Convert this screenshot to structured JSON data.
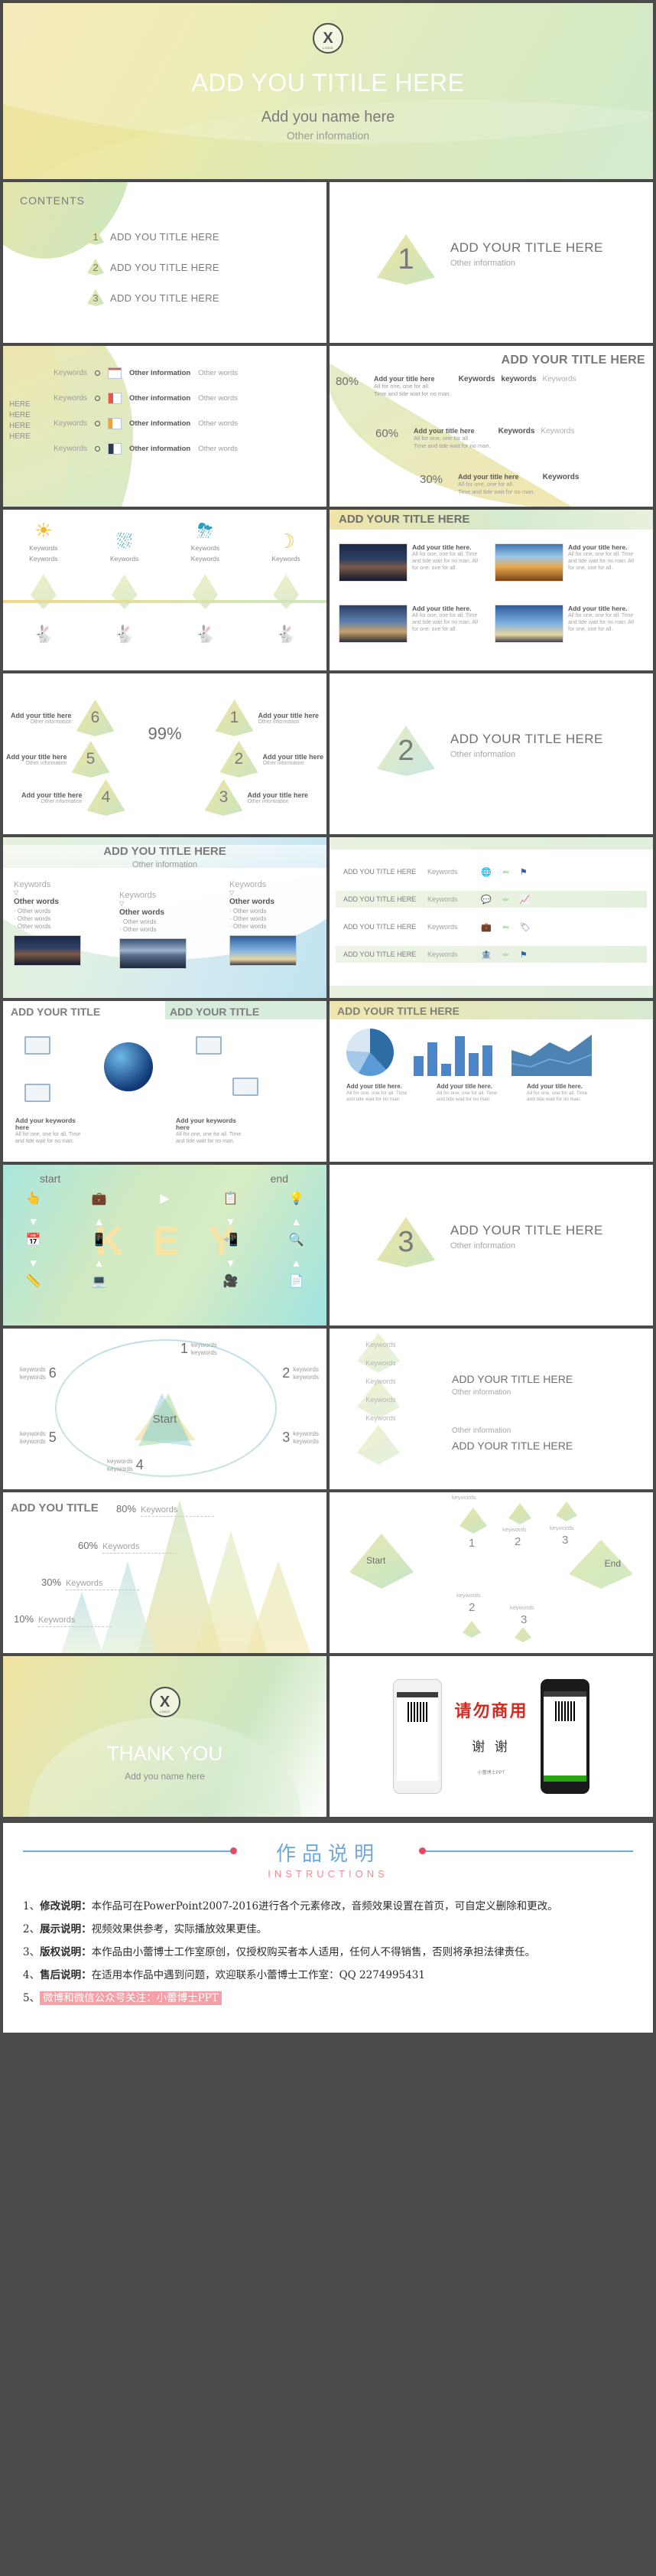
{
  "title_slide": {
    "logo": "X",
    "logo_sub": "LOGO",
    "title": "ADD YOU TITILE HERE",
    "name": "Add you name here",
    "subtitle": "Other information"
  },
  "contents_slide": {
    "heading": "CONTENTS",
    "items": [
      {
        "num": "1",
        "label": "ADD YOU TITLE HERE"
      },
      {
        "num": "2",
        "label": "ADD YOU TITLE HERE"
      },
      {
        "num": "3",
        "label": "ADD YOU TITLE HERE"
      }
    ]
  },
  "section1": {
    "num": "1",
    "title": "ADD YOUR TITLE HERE",
    "sub": "Other information"
  },
  "section2": {
    "num": "2",
    "title": "ADD YOUR TITLE HERE",
    "sub": "Other information"
  },
  "section3": {
    "num": "3",
    "title": "ADD YOUR TITLE HERE",
    "sub": "Other information"
  },
  "keywords_slide": {
    "side_labels": [
      "HERE",
      "HERE",
      "HERE",
      "HERE"
    ],
    "rows": [
      {
        "kw": "Keywords",
        "icon": "table-icon",
        "bold": "Other information",
        "light": "Other words"
      },
      {
        "kw": "Keywords",
        "icon": "contact-card-icon",
        "bold": "Other information",
        "light": "Other words"
      },
      {
        "kw": "Keywords",
        "icon": "chart-report-icon",
        "bold": "Other information",
        "light": "Other words"
      },
      {
        "kw": "Keywords",
        "icon": "media-page-icon",
        "bold": "Other information",
        "light": "Other words"
      }
    ]
  },
  "percent_slide": {
    "title": "ADD YOUR TITLE HERE",
    "rows": [
      {
        "pct": "80%",
        "title": "Add your title here",
        "line1": "All for one, one for all.",
        "line2": "Time and tide wait for no man.",
        "keywords": [
          "Keywords",
          "keywords",
          "Keywords"
        ]
      },
      {
        "pct": "60%",
        "title": "Add your title here",
        "line1": "All for one, one for all.",
        "line2": "Time and tide wait for no man.",
        "keywords": [
          "Keywords",
          "Keywords"
        ]
      },
      {
        "pct": "30%",
        "title": "Add your title here",
        "line1": "All for one, one for all.",
        "line2": "Time and tide wait for no man.",
        "keywords": [
          "Keywords"
        ]
      }
    ]
  },
  "weather_slide": {
    "columns": [
      {
        "icon": "sun-icon",
        "glyph": "☀",
        "color": "#f2b826",
        "labels": [
          "Keywords",
          "Keywords"
        ],
        "bunny": "bunny-blue-icon",
        "bunny_color": "#4aa8e0"
      },
      {
        "icon": "rain-cloud-icon",
        "glyph": "⛆",
        "color": "#2a9fc4",
        "labels": [
          "Keywords"
        ],
        "bunny": "bunny-yellow-icon",
        "bunny_color": "#e8c93c"
      },
      {
        "icon": "thunder-cloud-icon",
        "glyph": "⛈",
        "color": "#2a9fc4",
        "labels": [
          "Keywords",
          "Keywords"
        ],
        "bunny": "bunny-orange-icon",
        "bunny_color": "#f08a5d"
      },
      {
        "icon": "moon-icon",
        "glyph": "☽",
        "color": "#f2c23e",
        "labels": [
          "Keywords"
        ],
        "bunny": "bunny-green-icon",
        "bunny_color": "#7cc24a"
      }
    ]
  },
  "imagegrid_slide": {
    "title": "ADD YOUR TITLE HERE",
    "cells": [
      {
        "photo": "night-sea-photo",
        "title": "Add your title here.",
        "body": "All for one, one for all. Time and tide wait for no man. All for one, one for all."
      },
      {
        "photo": "sunset-sky-photo",
        "title": "Add your title here.",
        "body": "All for one, one for all. Time and tide wait for no man. All for one, one for all."
      },
      {
        "photo": "dawn-horizon-photo",
        "title": "Add your title here.",
        "body": "All for one, one for all. Time and tide wait for no man. All for one, one for all."
      },
      {
        "photo": "blue-sky-photo",
        "title": "Add your title here.",
        "body": "All for one, one for all. Time and tide wait for no man. All for one, one for all."
      }
    ]
  },
  "hex_slide": {
    "center": "99%",
    "nodes": [
      {
        "num": "6",
        "title": "Add your title here",
        "sub": "Other information",
        "side": "left"
      },
      {
        "num": "1",
        "title": "Add your title here",
        "sub": "Other information",
        "side": "right"
      },
      {
        "num": "5",
        "title": "Add your title here",
        "sub": "Other information",
        "side": "left"
      },
      {
        "num": "2",
        "title": "Add your title here",
        "sub": "Other information",
        "side": "right"
      },
      {
        "num": "4",
        "title": "Add your title here",
        "sub": "Other information",
        "side": "left"
      },
      {
        "num": "3",
        "title": "Add your title here",
        "sub": "Other information",
        "side": "right"
      }
    ]
  },
  "blue_slide": {
    "title": "ADD YOU TITLE HERE",
    "sub": "Other information",
    "columns": [
      {
        "kw": "Keywords",
        "head": "Other words",
        "bullets": [
          "Other words",
          "Other words",
          "Other words"
        ],
        "photo": "night-sea-photo"
      },
      {
        "kw": "Keywords",
        "head": "Other words",
        "bullets": [
          "Other words",
          "Other words"
        ],
        "photo": "lake-reflection-photo"
      },
      {
        "kw": "Keywords",
        "head": "Other words",
        "bullets": [
          "Other words",
          "Other words",
          "Other words"
        ],
        "photo": "blue-sky-photo"
      }
    ]
  },
  "list_slide": {
    "rows": [
      {
        "title": "ADD YOU TITLE HERE",
        "kw": "Keywords",
        "icons": [
          "globe-icon",
          "arrow-left-icon",
          "flag-icon"
        ]
      },
      {
        "title": "ADD YOU TITLE HERE",
        "kw": "Keywords",
        "icons": [
          "speech-bubble-icon",
          "arrow-left-icon",
          "chart-icon"
        ]
      },
      {
        "title": "ADD YOU TITLE HERE",
        "kw": "Keywords",
        "icons": [
          "bag-icon",
          "arrow-left-icon",
          "tag-icon"
        ]
      },
      {
        "title": "ADD YOU TITLE HERE",
        "kw": "Keywords",
        "icons": [
          "bank-icon",
          "arrow-left-icon",
          "flag-icon"
        ]
      }
    ]
  },
  "diagram_slide": {
    "title_left": "ADD YOUR TITLE",
    "title_right": "ADD YOUR TITLE",
    "captions": [
      {
        "title": "Add your keywords here",
        "body": "All for one, one for all. Time and tide wait for no man."
      },
      {
        "title": "Add your keywords here",
        "body": "All for one, one for all. Time and tide wait for no man."
      }
    ]
  },
  "chart_slide": {
    "title": "ADD YOUR TITLE HERE",
    "captions": [
      {
        "title": "Add your title here.",
        "body": "All for one, one for all. Time and tide wait for no man."
      },
      {
        "title": "Add your title here.",
        "body": "All for one, one for all. Time and tide wait for no man."
      },
      {
        "title": "Add your title here.",
        "body": "All for one, one for all. Time and tide wait for no man."
      }
    ]
  },
  "key_slide": {
    "start_label": "start",
    "end_label": "end",
    "letters": [
      "K",
      "E",
      "Y"
    ],
    "icons_row1": [
      "hand-click-icon",
      "briefcase-icon",
      "play-icon",
      "id-card-icon",
      "lightbulb-icon"
    ],
    "icons_row2": [
      "calendar-icon",
      "phone-icon",
      "mobile-app-icon",
      "magnifier-icon"
    ],
    "icons_row3": [
      "ruler-icon",
      "laptop-icon",
      "video-icon",
      "browser-icon"
    ]
  },
  "circle_slide": {
    "center": "Start",
    "nodes": [
      {
        "num": "1",
        "kw": [
          "keywords",
          "keywords"
        ]
      },
      {
        "num": "2",
        "kw": [
          "keywords",
          "keywords"
        ]
      },
      {
        "num": "3",
        "kw": [
          "keywords",
          "keywords"
        ]
      },
      {
        "num": "4",
        "kw": [
          "keywords",
          "keywords"
        ]
      },
      {
        "num": "5",
        "kw": [
          "keywords",
          "keywords"
        ]
      },
      {
        "num": "6",
        "kw": [
          "keywords",
          "keywords"
        ]
      }
    ]
  },
  "stack_slide": {
    "keywords": [
      "Keywords",
      "Keywords",
      "Keywords",
      "Keywords",
      "Keywords"
    ],
    "title": "ADD YOUR TITLE HERE",
    "sub": "Other information",
    "sub2": "Other information",
    "title2": "ADD YOUR TITLE HERE"
  },
  "mountain_slide": {
    "title": "ADD YOU TITLE",
    "rows": [
      {
        "pct": "80%",
        "kw": "Keywords"
      },
      {
        "pct": "60%",
        "kw": "Keywords"
      },
      {
        "pct": "30%",
        "kw": "Keywords"
      },
      {
        "pct": "10%",
        "kw": "Keywords"
      }
    ]
  },
  "flow_slide": {
    "start": "Start",
    "end": "End",
    "nodes": [
      {
        "num": "1",
        "kw": "keywords"
      },
      {
        "num": "2",
        "kw": "keywords"
      },
      {
        "num": "3",
        "kw": "keywords"
      },
      {
        "num": "2",
        "kw": "keywords"
      },
      {
        "num": "3",
        "kw": "keywords"
      }
    ]
  },
  "thanks_slide": {
    "logo": "X",
    "logo_sub": "LOGO",
    "title": "THANK YOU",
    "name": "Add you name here"
  },
  "phones_slide": {
    "red_title": "请勿商用",
    "thanks": "谢 谢",
    "footer": "小蕾博士PPT"
  },
  "instructions": {
    "title_cn": "作品说明",
    "title_en": "INSTRUCTIONS",
    "items": [
      {
        "no": "1、",
        "bold": "修改说明：",
        "text": "本作品可在PowerPoint2007-2016进行各个元素修改，音频效果设置在首页，可自定义删除和更改。"
      },
      {
        "no": "2、",
        "bold": "展示说明：",
        "text": "视频效果供参考，实际播放效果更佳。"
      },
      {
        "no": "3、",
        "bold": "版权说明：",
        "text": "本作品由小蕾博士工作室原创，仅授权购买者本人适用，任何人不得销售，否则将承担法律责任。"
      },
      {
        "no": "4、",
        "bold": "售后说明：",
        "text": "在适用本作品中遇到问题，欢迎联系小蕾博士工作室：QQ 2274995431"
      },
      {
        "no": "5、",
        "bold": "",
        "text": "微博和微信公众号关注：小蕾博士PPT",
        "highlight": true
      }
    ]
  }
}
